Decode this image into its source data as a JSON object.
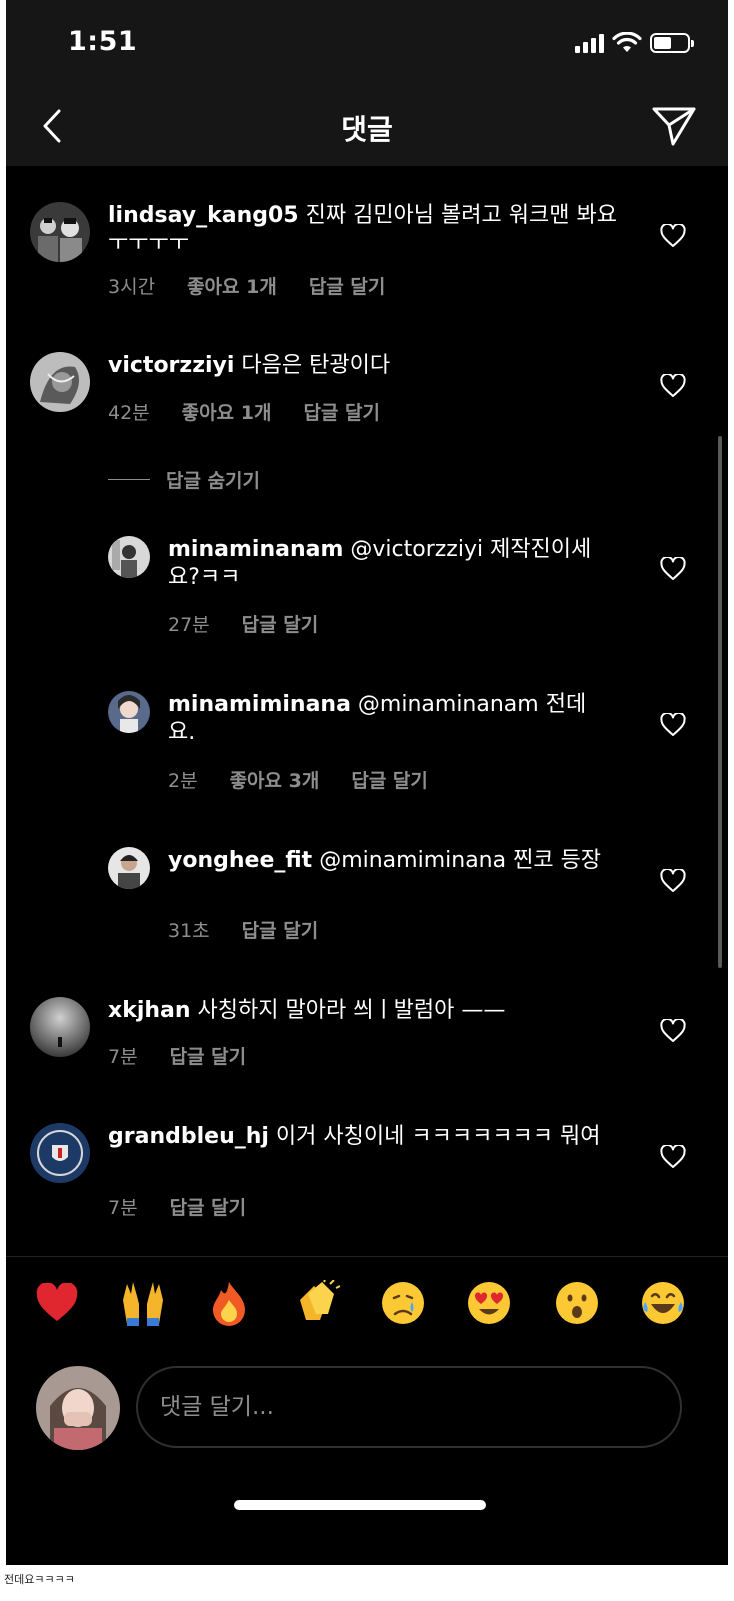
{
  "status": {
    "time": "1:51"
  },
  "header": {
    "title": "댓글"
  },
  "comments": [
    {
      "username": "lindsay_kang05",
      "text": " 진짜 김민아님 볼려고 워크맨 봐요ㅜㅜㅜㅜ",
      "time": "3시간",
      "likes": "좋아요 1개",
      "reply": "답글 달기"
    },
    {
      "username": "victorzziyi",
      "text": " 다음은 탄광이다",
      "time": "42분",
      "likes": "좋아요 1개",
      "reply": "답글 달기"
    },
    {
      "username": "xkjhan",
      "text": " 사칭하지 말아라 씌ㅣ발럼아 ——",
      "time": "7분",
      "reply": "답글 달기"
    },
    {
      "username": "grandbleu_hj",
      "text": " 이거 사칭이네 ㅋㅋㅋㅋㅋㅋㅋ 뭐여",
      "time": "7분",
      "reply": "답글 달기"
    }
  ],
  "hide_replies": "답글 숨기기",
  "replies": [
    {
      "username": "minaminanam",
      "text": " @victorzziyi 제작진이세요?ㅋㅋ",
      "time": "27분",
      "reply": "답글 달기"
    },
    {
      "username": "minamiminana",
      "text": " @minaminanam 전데요.",
      "time": "2분",
      "likes": "좋아요 3개",
      "reply": "답글 달기"
    },
    {
      "username": "yonghee_fit",
      "text": " @minamiminana 찐코 등장",
      "time": "31초",
      "reply": "답글 달기"
    }
  ],
  "emojis": [
    "heart-emoji",
    "raising-hands-emoji",
    "fire-emoji",
    "clapping-emoji",
    "crying-emoji",
    "heart-eyes-emoji",
    "surprised-emoji",
    "laughing-emoji"
  ],
  "composer": {
    "placeholder": "댓글 달기..."
  },
  "caption": "전데요ㅋㅋㅋㅋ"
}
